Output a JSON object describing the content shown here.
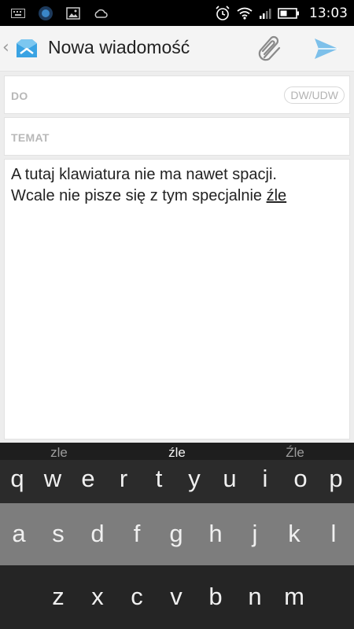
{
  "status_bar": {
    "time": "13:03",
    "left_icons": [
      "keyboard-icon",
      "circle-app-icon",
      "image-icon",
      "weather-icon"
    ],
    "right_icons": [
      "alarm-icon",
      "wifi-icon",
      "signal-icon",
      "battery-icon"
    ]
  },
  "app_bar": {
    "title": "Nowa wiadomość",
    "back_icon": "chevron-left-icon",
    "logo_icon": "mail-app-logo-icon",
    "attach_icon": "paperclip-icon",
    "send_icon": "send-icon",
    "accent_color": "#3aa3e3"
  },
  "compose": {
    "to_label": "DO",
    "ccbcc_label": "DW/UDW",
    "subject_label": "TEMAT",
    "body_line1": "A tutaj klawiatura nie ma nawet spacji.",
    "body_line2_prefix": "Wcale nie pisze się z tym specjalnie ",
    "body_line2_word": "źle"
  },
  "keyboard": {
    "suggestions": [
      "zle",
      "źle",
      "Źle"
    ],
    "row1": [
      "q",
      "w",
      "e",
      "r",
      "t",
      "y",
      "u",
      "i",
      "o",
      "p"
    ],
    "row2": [
      "a",
      "s",
      "d",
      "f",
      "g",
      "h",
      "j",
      "k",
      "l"
    ],
    "row3": [
      "z",
      "x",
      "c",
      "v",
      "b",
      "n",
      "m"
    ]
  }
}
